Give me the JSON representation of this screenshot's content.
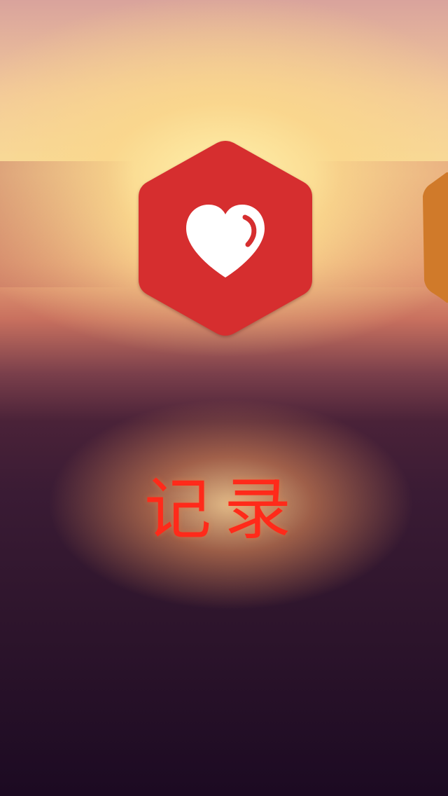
{
  "feature": {
    "title": "记录",
    "icon": "heart-icon",
    "card_color": "#d62e2f",
    "next_card_color": "#d07a2a",
    "title_color": "#ff2a1a"
  }
}
